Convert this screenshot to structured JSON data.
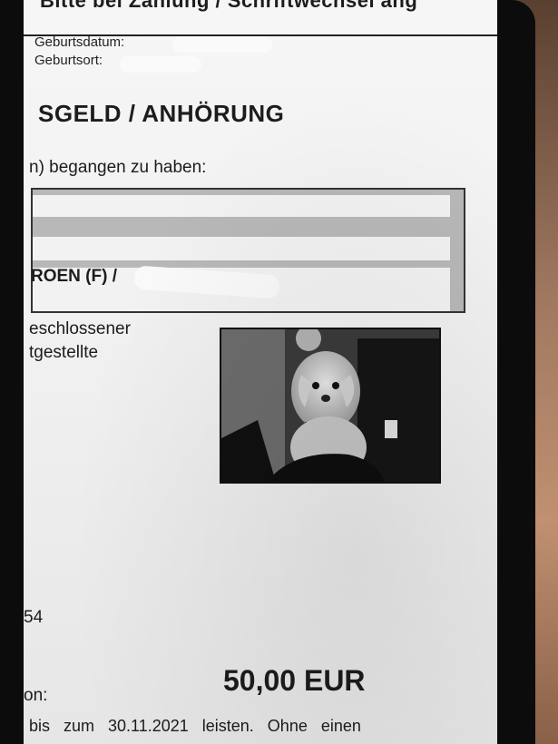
{
  "document": {
    "header": "Bitte bei Zahlung / Schriftwechsel ang",
    "birthdate_label": "Geburtsdatum:",
    "birthplace_label": "Geburtsort:",
    "title": "SGELD / ANHÖRUNG",
    "intro": "n) begangen zu haben:",
    "vehicle": "ROEN (F) /",
    "side_text_1": "eschlossener",
    "side_text_2": "tgestellte",
    "reference": "54",
    "amount": "50,00 EUR",
    "payment_label": "on:",
    "deadline": "bis zum 30.11.2021 leisten. Ohne einen"
  },
  "photo": {
    "subject": "dog-in-driver-seat",
    "color": "#d8d8d8"
  },
  "colors": {
    "paper": "#f2f2f2",
    "phone_frame": "#0c0c0c",
    "redaction": "#fafafa"
  }
}
